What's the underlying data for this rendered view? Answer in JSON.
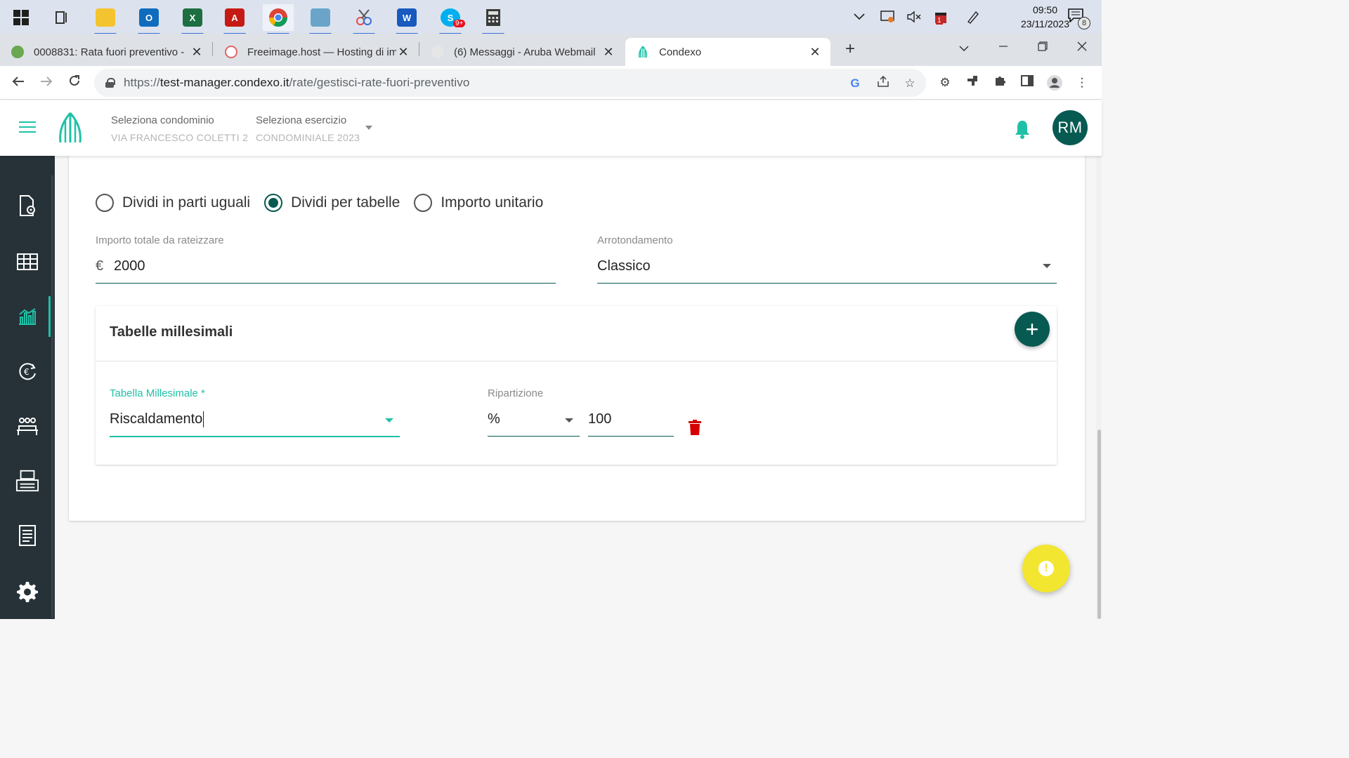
{
  "taskbar": {
    "apps": [
      {
        "name": "windows-start",
        "color": "#1f1f1f"
      },
      {
        "name": "task-view",
        "color": "#333333"
      },
      {
        "name": "file-explorer",
        "color": "#f4c430"
      },
      {
        "name": "outlook",
        "color": "#0f6cbd"
      },
      {
        "name": "excel",
        "color": "#1d6f42"
      },
      {
        "name": "acrobat",
        "color": "#c51a13"
      },
      {
        "name": "chrome",
        "color": "#4285f4"
      },
      {
        "name": "notes",
        "color": "#6aa5c9"
      },
      {
        "name": "snipping-tool",
        "color": "#e34c4c"
      },
      {
        "name": "word",
        "color": "#185abd"
      },
      {
        "name": "skype",
        "color": "#00aff0"
      },
      {
        "name": "calculator",
        "color": "#3a3a3a"
      }
    ],
    "skype_badge": "9+",
    "clock": {
      "time": "09:50",
      "date": "23/11/2023"
    },
    "notification_count": "8",
    "calendar_badge": "1"
  },
  "browser": {
    "tabs": [
      {
        "title": "0008831: Rata fuori preventivo -",
        "favicon_color": "#6aa84f"
      },
      {
        "title": "Freeimage.host — Hosting di im",
        "favicon_color": "#e06666"
      },
      {
        "title": "(6) Messaggi - Aruba Webmail",
        "favicon_color": "#cccccc"
      },
      {
        "title": "Condexo",
        "favicon_color": "#1fc1a6"
      }
    ],
    "url_prefix": "https://",
    "url_host": "test-manager.condexo.it",
    "url_path": "/rate/gestisci-rate-fuori-preventivo"
  },
  "header": {
    "condominio_label": "Seleziona condominio",
    "condominio_value": "VIA FRANCESCO COLETTI 2",
    "esercizio_label": "Seleziona esercizio",
    "esercizio_value": "CONDOMINIALE 2023",
    "avatar_initials": "RM"
  },
  "form": {
    "radio_options": [
      {
        "label": "Dividi in parti uguali",
        "checked": false
      },
      {
        "label": "Dividi per tabelle",
        "checked": true
      },
      {
        "label": "Importo unitario",
        "checked": false
      }
    ],
    "importo_label": "Importo totale da rateizzare",
    "currency_symbol": "€",
    "importo_value": "2000",
    "arrotondamento_label": "Arrotondamento",
    "arrotondamento_value": "Classico"
  },
  "tabelle": {
    "title": "Tabelle millesimali",
    "add_label": "+",
    "tabella_label": "Tabella Millesimale *",
    "tabella_value": "Riscaldamento",
    "ripartizione_label": "Ripartizione",
    "ripartizione_unit": "%",
    "ripartizione_value": "100"
  },
  "colors": {
    "accent": "#1fc1a6",
    "primary_dark": "#075a52",
    "sidebar": "#263238",
    "delete": "#d50000",
    "alert_fab": "#f3e630"
  }
}
